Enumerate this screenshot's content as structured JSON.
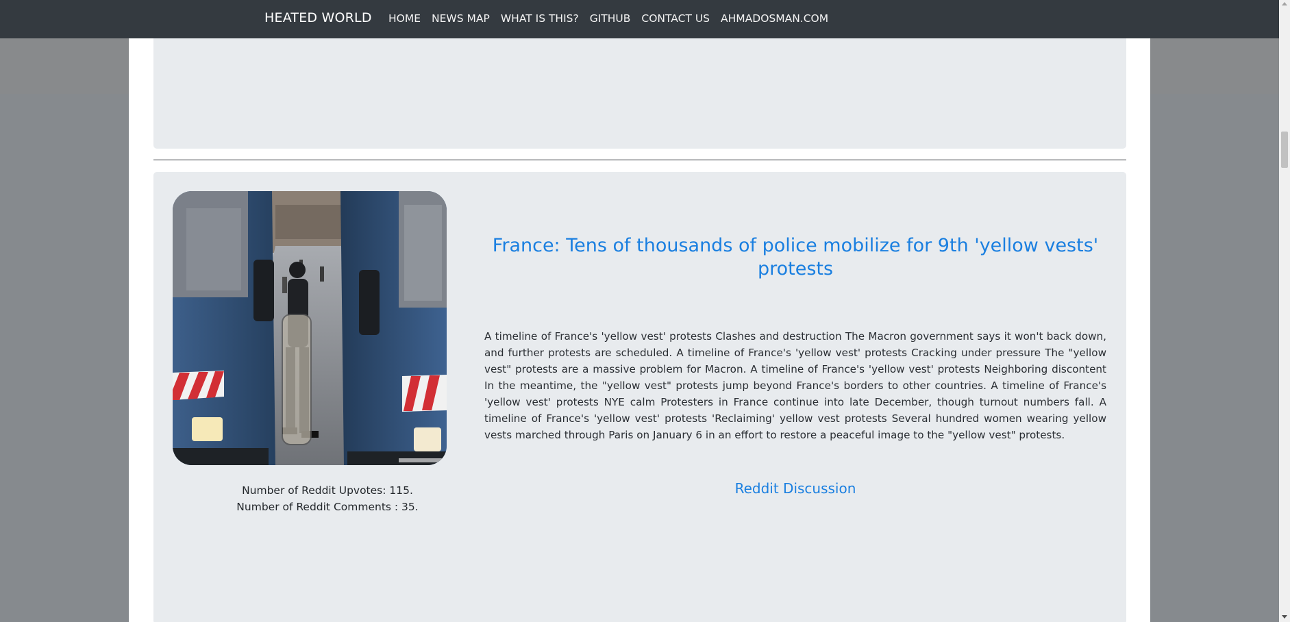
{
  "navbar": {
    "brand": "HEATED WORLD",
    "links": [
      "HOME",
      "NEWS MAP",
      "WHAT IS THIS?",
      "GITHUB",
      "CONTACT US",
      "AHMADOSMAN.COM"
    ]
  },
  "article": {
    "title": "France: Tens of thousands of police mobilize for 9th 'yellow vests' protests",
    "body": "A timeline of France's 'yellow vest' protests Clashes and destruction The Macron government says it won't back down, and further protests are scheduled. A timeline of France's 'yellow vest' protests Cracking under pressure The \"yellow vest\" protests are a massive problem for Macron. A timeline of France's 'yellow vest' protests Neighboring discontent In the meantime, the \"yellow vest\" protests jump beyond France's borders to other countries. A timeline of France's 'yellow vest' protests NYE calm Protesters in France continue into late December, though turnout numbers fall. A timeline of France's 'yellow vest' protests 'Reclaiming' yellow vest protests Several hundred women wearing yellow vests marched through Paris on January 6 in an effort to restore a peaceful image to the \"yellow vest\" protests.",
    "upvotes_text": "Number of Reddit Upvotes: 115.",
    "comments_text": "Number of Reddit Comments : 35.",
    "link_label": "Reddit Discussion",
    "image_alt": "police officer between two police vans"
  },
  "colors": {
    "navbar_bg": "#343a40",
    "link_blue": "#1a7fe0",
    "card_bg": "#e8ebee"
  }
}
